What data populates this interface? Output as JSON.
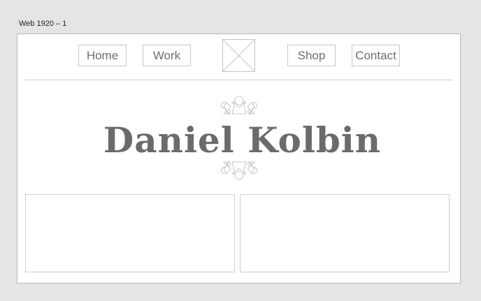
{
  "artboard": {
    "label": "Web 1920 – 1"
  },
  "nav": {
    "home": "Home",
    "work": "Work",
    "shop": "Shop",
    "contact": "Contact"
  },
  "hero": {
    "title": "Daniel Kolbin"
  },
  "icons": {
    "logo": "image-placeholder-icon",
    "ornament_top": "flourish-ornament-icon",
    "ornament_bottom": "flourish-ornament-icon"
  },
  "colors": {
    "background": "#e5e5e5",
    "artboard": "#ffffff",
    "text": "#6b6b6b",
    "border": "#cfcfcf"
  }
}
